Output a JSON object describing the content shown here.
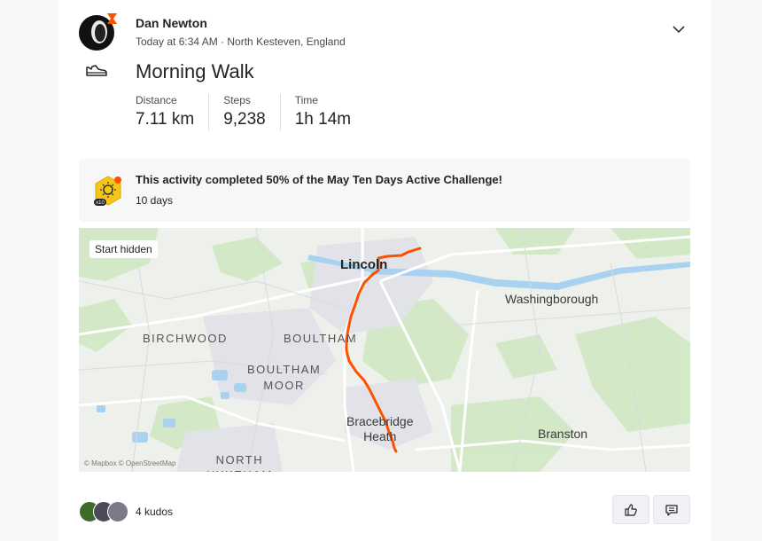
{
  "athlete": {
    "name": "Dan Newton",
    "meta": "Today at 6:34 AM · North Kesteven, England"
  },
  "activity": {
    "sport_icon": "shoe-icon",
    "title": "Morning Walk",
    "stats": [
      {
        "label": "Distance",
        "value": "7.11 km"
      },
      {
        "label": "Steps",
        "value": "9,238"
      },
      {
        "label": "Time",
        "value": "1h 14m"
      }
    ]
  },
  "challenge": {
    "text": "This activity completed 50% of the May Ten Days Active Challenge!",
    "subtext": "10 days",
    "icon": "challenge-badge-icon",
    "badge_text": "x10"
  },
  "map": {
    "start_hidden_label": "Start hidden",
    "labels": {
      "lincoln": "Lincoln",
      "washingborough": "Washingborough",
      "birchwood": "BIRCHWOOD",
      "boultham": "BOULTHAM",
      "boultham_moor": "BOULTHAM\nMOOR",
      "bracebridge": "Bracebridge\nHeath",
      "branston": "Branston",
      "north_hykeham": "NORTH\nHYKEHAM"
    },
    "attribution": "© Mapbox © OpenStreetMap",
    "route_color": "#fc5200"
  },
  "kudos": {
    "count_label": "4 kudos"
  },
  "colors": {
    "brand": "#fc5200",
    "water": "#a8d2f0",
    "park": "#cfe8c4"
  }
}
